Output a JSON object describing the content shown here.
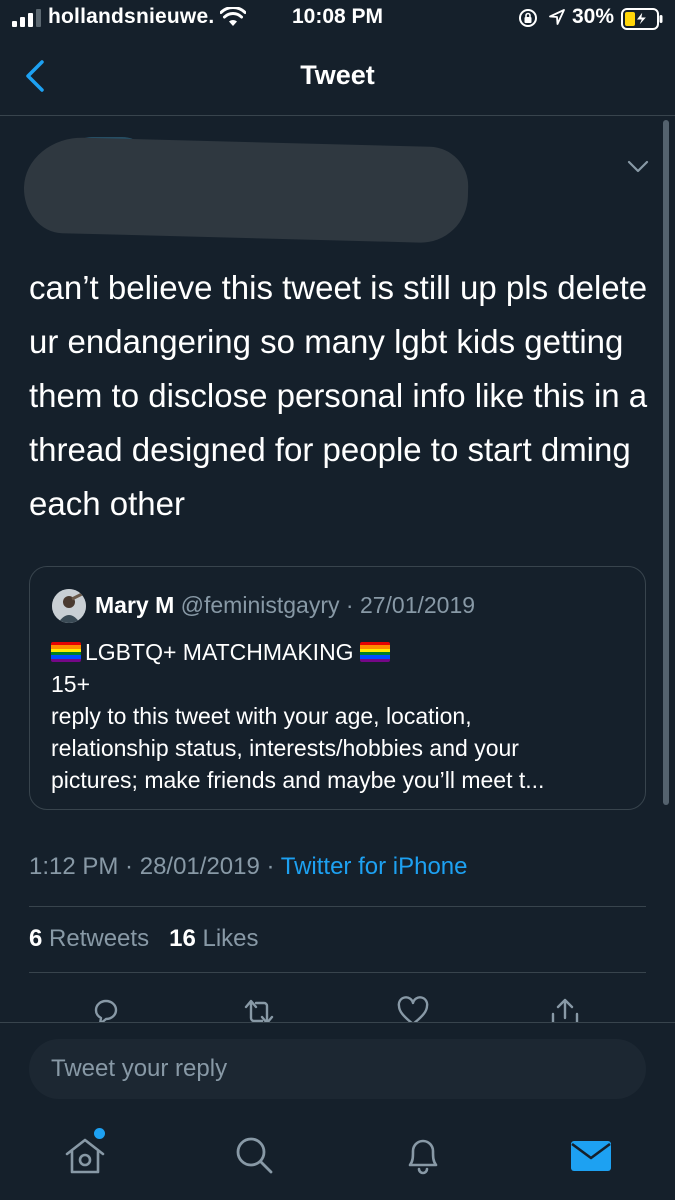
{
  "status_bar": {
    "carrier": "hollandsnieuwe.",
    "time": "10:08 PM",
    "battery_percent": "30%",
    "icons": [
      "signal-icon",
      "wifi-icon",
      "orientation-lock-icon",
      "location-icon",
      "battery-charging-icon"
    ]
  },
  "header": {
    "title": "Tweet",
    "back_icon": "chevron-left-icon"
  },
  "tweet": {
    "text": "can’t believe this tweet is still up pls delete ur endangering so many lgbt kids getting them to disclose personal info like this in a thread designed for people to start dming each other",
    "meta_time": "1:12 PM",
    "meta_sep1": " · ",
    "meta_date": "28/01/2019",
    "meta_sep2": " · ",
    "meta_source": "Twitter for iPhone",
    "retweets_count": "6",
    "retweets_label": "Retweets",
    "likes_count": "16",
    "likes_label": "Likes"
  },
  "quoted_tweet": {
    "name": "Mary M",
    "handle": "@feministgayry",
    "sep": " · ",
    "date": "27/01/2019",
    "line1": "LGBTQ+ MATCHMAKING",
    "line2": "15+",
    "line3": "reply to this tweet with your age, location,",
    "line4": "relationship status, interests/hobbies and your",
    "line5": "pictures; make friends and maybe you’ll meet t..."
  },
  "reply": {
    "placeholder": "Tweet your reply"
  },
  "colors": {
    "background": "#15202b",
    "accent": "#1da1f2",
    "muted": "#8899a6",
    "border": "#38444d",
    "battery_charging": "#ffd60a"
  },
  "tab_bar": {
    "tabs": [
      "home-icon",
      "search-icon",
      "notifications-icon",
      "messages-icon"
    ],
    "active": "messages-icon"
  }
}
